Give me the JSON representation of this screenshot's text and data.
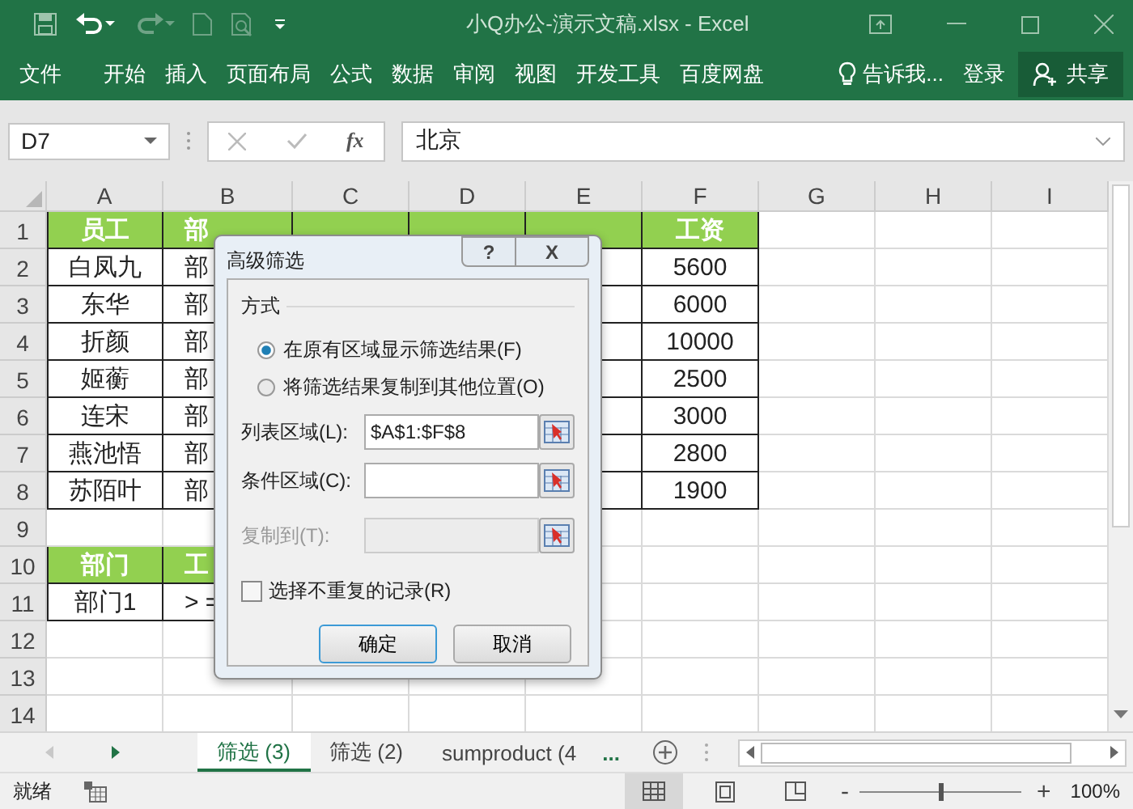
{
  "window": {
    "title": "小Q办公-演示文稿.xlsx - Excel"
  },
  "ribbon_tabs": [
    {
      "label": "文件",
      "selected": false
    },
    {
      "label": "开始",
      "selected": false
    },
    {
      "label": "插入",
      "selected": false
    },
    {
      "label": "页面布局",
      "selected": false
    },
    {
      "label": "公式",
      "selected": false
    },
    {
      "label": "数据",
      "selected": false
    },
    {
      "label": "审阅",
      "selected": false
    },
    {
      "label": "视图",
      "selected": false
    },
    {
      "label": "开发工具",
      "selected": false
    },
    {
      "label": "百度网盘",
      "selected": false
    }
  ],
  "tell_me": "告诉我...",
  "sign_in": "登录",
  "share": "共享",
  "formula_bar": {
    "name_box": "D7",
    "function_button": "fx",
    "value": "北京"
  },
  "sheet": {
    "columns": [
      "A",
      "B",
      "C",
      "D",
      "E",
      "F",
      "G",
      "H",
      "I"
    ],
    "rows": [
      {
        "number": "1",
        "cells": [
          {
            "text": "员工",
            "kind": "header"
          },
          {
            "text": "部",
            "kind": "header"
          },
          {
            "kind": "header"
          },
          {
            "kind": "header"
          },
          {
            "kind": "header"
          },
          {
            "text": "工资",
            "kind": "header"
          }
        ]
      },
      {
        "number": "2",
        "cells": [
          {
            "text": "白凤九",
            "kind": "data"
          },
          {
            "text": "部",
            "kind": "data"
          },
          null,
          null,
          {
            "kind": "data"
          },
          {
            "text": "5600",
            "kind": "data"
          }
        ]
      },
      {
        "number": "3",
        "cells": [
          {
            "text": "东华",
            "kind": "data"
          },
          {
            "text": "部",
            "kind": "data"
          },
          null,
          null,
          {
            "kind": "data"
          },
          {
            "text": "6000",
            "kind": "data"
          }
        ]
      },
      {
        "number": "4",
        "cells": [
          {
            "text": "折颜",
            "kind": "data"
          },
          {
            "text": "部",
            "kind": "data"
          },
          {
            "kind": "data"
          },
          {
            "kind": "data"
          },
          {
            "kind": "data"
          },
          {
            "text": "10000",
            "kind": "data"
          }
        ]
      },
      {
        "number": "5",
        "cells": [
          {
            "text": "姬蘅",
            "kind": "data"
          },
          {
            "text": "部",
            "kind": "data"
          },
          {
            "kind": "data"
          },
          {
            "kind": "data"
          },
          {
            "kind": "data"
          },
          {
            "text": "2500",
            "kind": "data"
          }
        ]
      },
      {
        "number": "6",
        "cells": [
          {
            "text": "连宋",
            "kind": "data"
          },
          {
            "text": "部",
            "kind": "data"
          },
          {
            "kind": "data"
          },
          {
            "kind": "data"
          },
          {
            "kind": "data"
          },
          {
            "text": "3000",
            "kind": "data"
          }
        ]
      },
      {
        "number": "7",
        "cells": [
          {
            "text": "燕池悟",
            "kind": "data"
          },
          {
            "text": "部",
            "kind": "data"
          },
          {
            "kind": "data"
          },
          {
            "kind": "data"
          },
          {
            "kind": "data"
          },
          {
            "text": "2800",
            "kind": "data"
          }
        ]
      },
      {
        "number": "8",
        "cells": [
          {
            "text": "苏陌叶",
            "kind": "data"
          },
          {
            "text": "部",
            "kind": "data"
          },
          {
            "kind": "data"
          },
          {
            "kind": "data"
          },
          {
            "kind": "data"
          },
          {
            "text": "1900",
            "kind": "data"
          }
        ]
      },
      {
        "number": "9",
        "cells": []
      },
      {
        "number": "10",
        "cells": [
          {
            "text": "部门",
            "kind": "header"
          },
          {
            "text": "工",
            "kind": "header"
          }
        ]
      },
      {
        "number": "11",
        "cells": [
          {
            "text": "部门1",
            "kind": "data"
          },
          {
            "text": "> =",
            "kind": "data"
          }
        ]
      },
      {
        "number": "12",
        "cells": []
      },
      {
        "number": "13",
        "cells": []
      },
      {
        "number": "14",
        "cells": []
      }
    ]
  },
  "dialog": {
    "title": "高级筛选",
    "help": "?",
    "close": "X",
    "group": "方式",
    "radios": [
      {
        "label": "在原有区域显示筛选结果(F)",
        "selected": true
      },
      {
        "label": "将筛选结果复制到其他位置(O)",
        "selected": false
      }
    ],
    "fields": [
      {
        "label": "列表区域(L):",
        "value": "$A$1:$F$8",
        "disabled": false
      },
      {
        "label": "条件区域(C):",
        "disabled": false
      },
      {
        "label": "复制到(T):",
        "disabled": true
      }
    ],
    "checkbox": {
      "label": "选择不重复的记录(R)",
      "checked": false
    },
    "buttons": [
      "确定",
      "取消"
    ]
  },
  "sheet_tabs": [
    {
      "label": "筛选 (3)",
      "selected": true
    },
    {
      "label": "筛选 (2)",
      "selected": false
    },
    {
      "label": "sumproduct (4",
      "selected": false
    }
  ],
  "more_tabs": "...",
  "status_bar": {
    "status": "就绪",
    "zoom_out": "-",
    "zoom_in": "+",
    "zoom": {
      "level": 0.5
    },
    "zoom_text": "100%"
  }
}
